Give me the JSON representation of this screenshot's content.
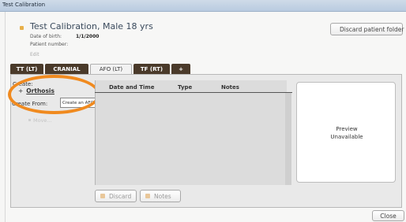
{
  "window": {
    "title": "Test Calibration"
  },
  "patient": {
    "name": "Test Calibration,  Male 18 yrs",
    "dob_label": "Date of birth:",
    "dob_value": "1/1/2000",
    "patient_number_label": "Patient number:",
    "edit_label": "Edit"
  },
  "header": {
    "discard_folder_label": "Discard patient folder"
  },
  "tabs": [
    {
      "label": "TT (LT)"
    },
    {
      "label": "CRANIAL"
    },
    {
      "label": "AFO (LT)"
    },
    {
      "label": "TF (RT)"
    },
    {
      "label": "+"
    }
  ],
  "left_pane": {
    "create_label": "Create:",
    "orthosis_prefix": "+",
    "orthosis_label": "Orthosis",
    "create_from_label": "Create From:",
    "create_from_value": "Create an AFO",
    "muted_item": "Move..."
  },
  "table": {
    "columns": [
      "Date and Time",
      "Type",
      "Notes"
    ]
  },
  "preview": {
    "line1": "Preview",
    "line2": "Unavailable"
  },
  "actions": {
    "discard_label": "Discard",
    "notes_label": "Notes"
  },
  "footer": {
    "close_label": "Close"
  },
  "colors": {
    "accent_orange": "#f08a1f",
    "tab_dark": "#4a3a2a",
    "icon_gold": "#e7b45c"
  }
}
